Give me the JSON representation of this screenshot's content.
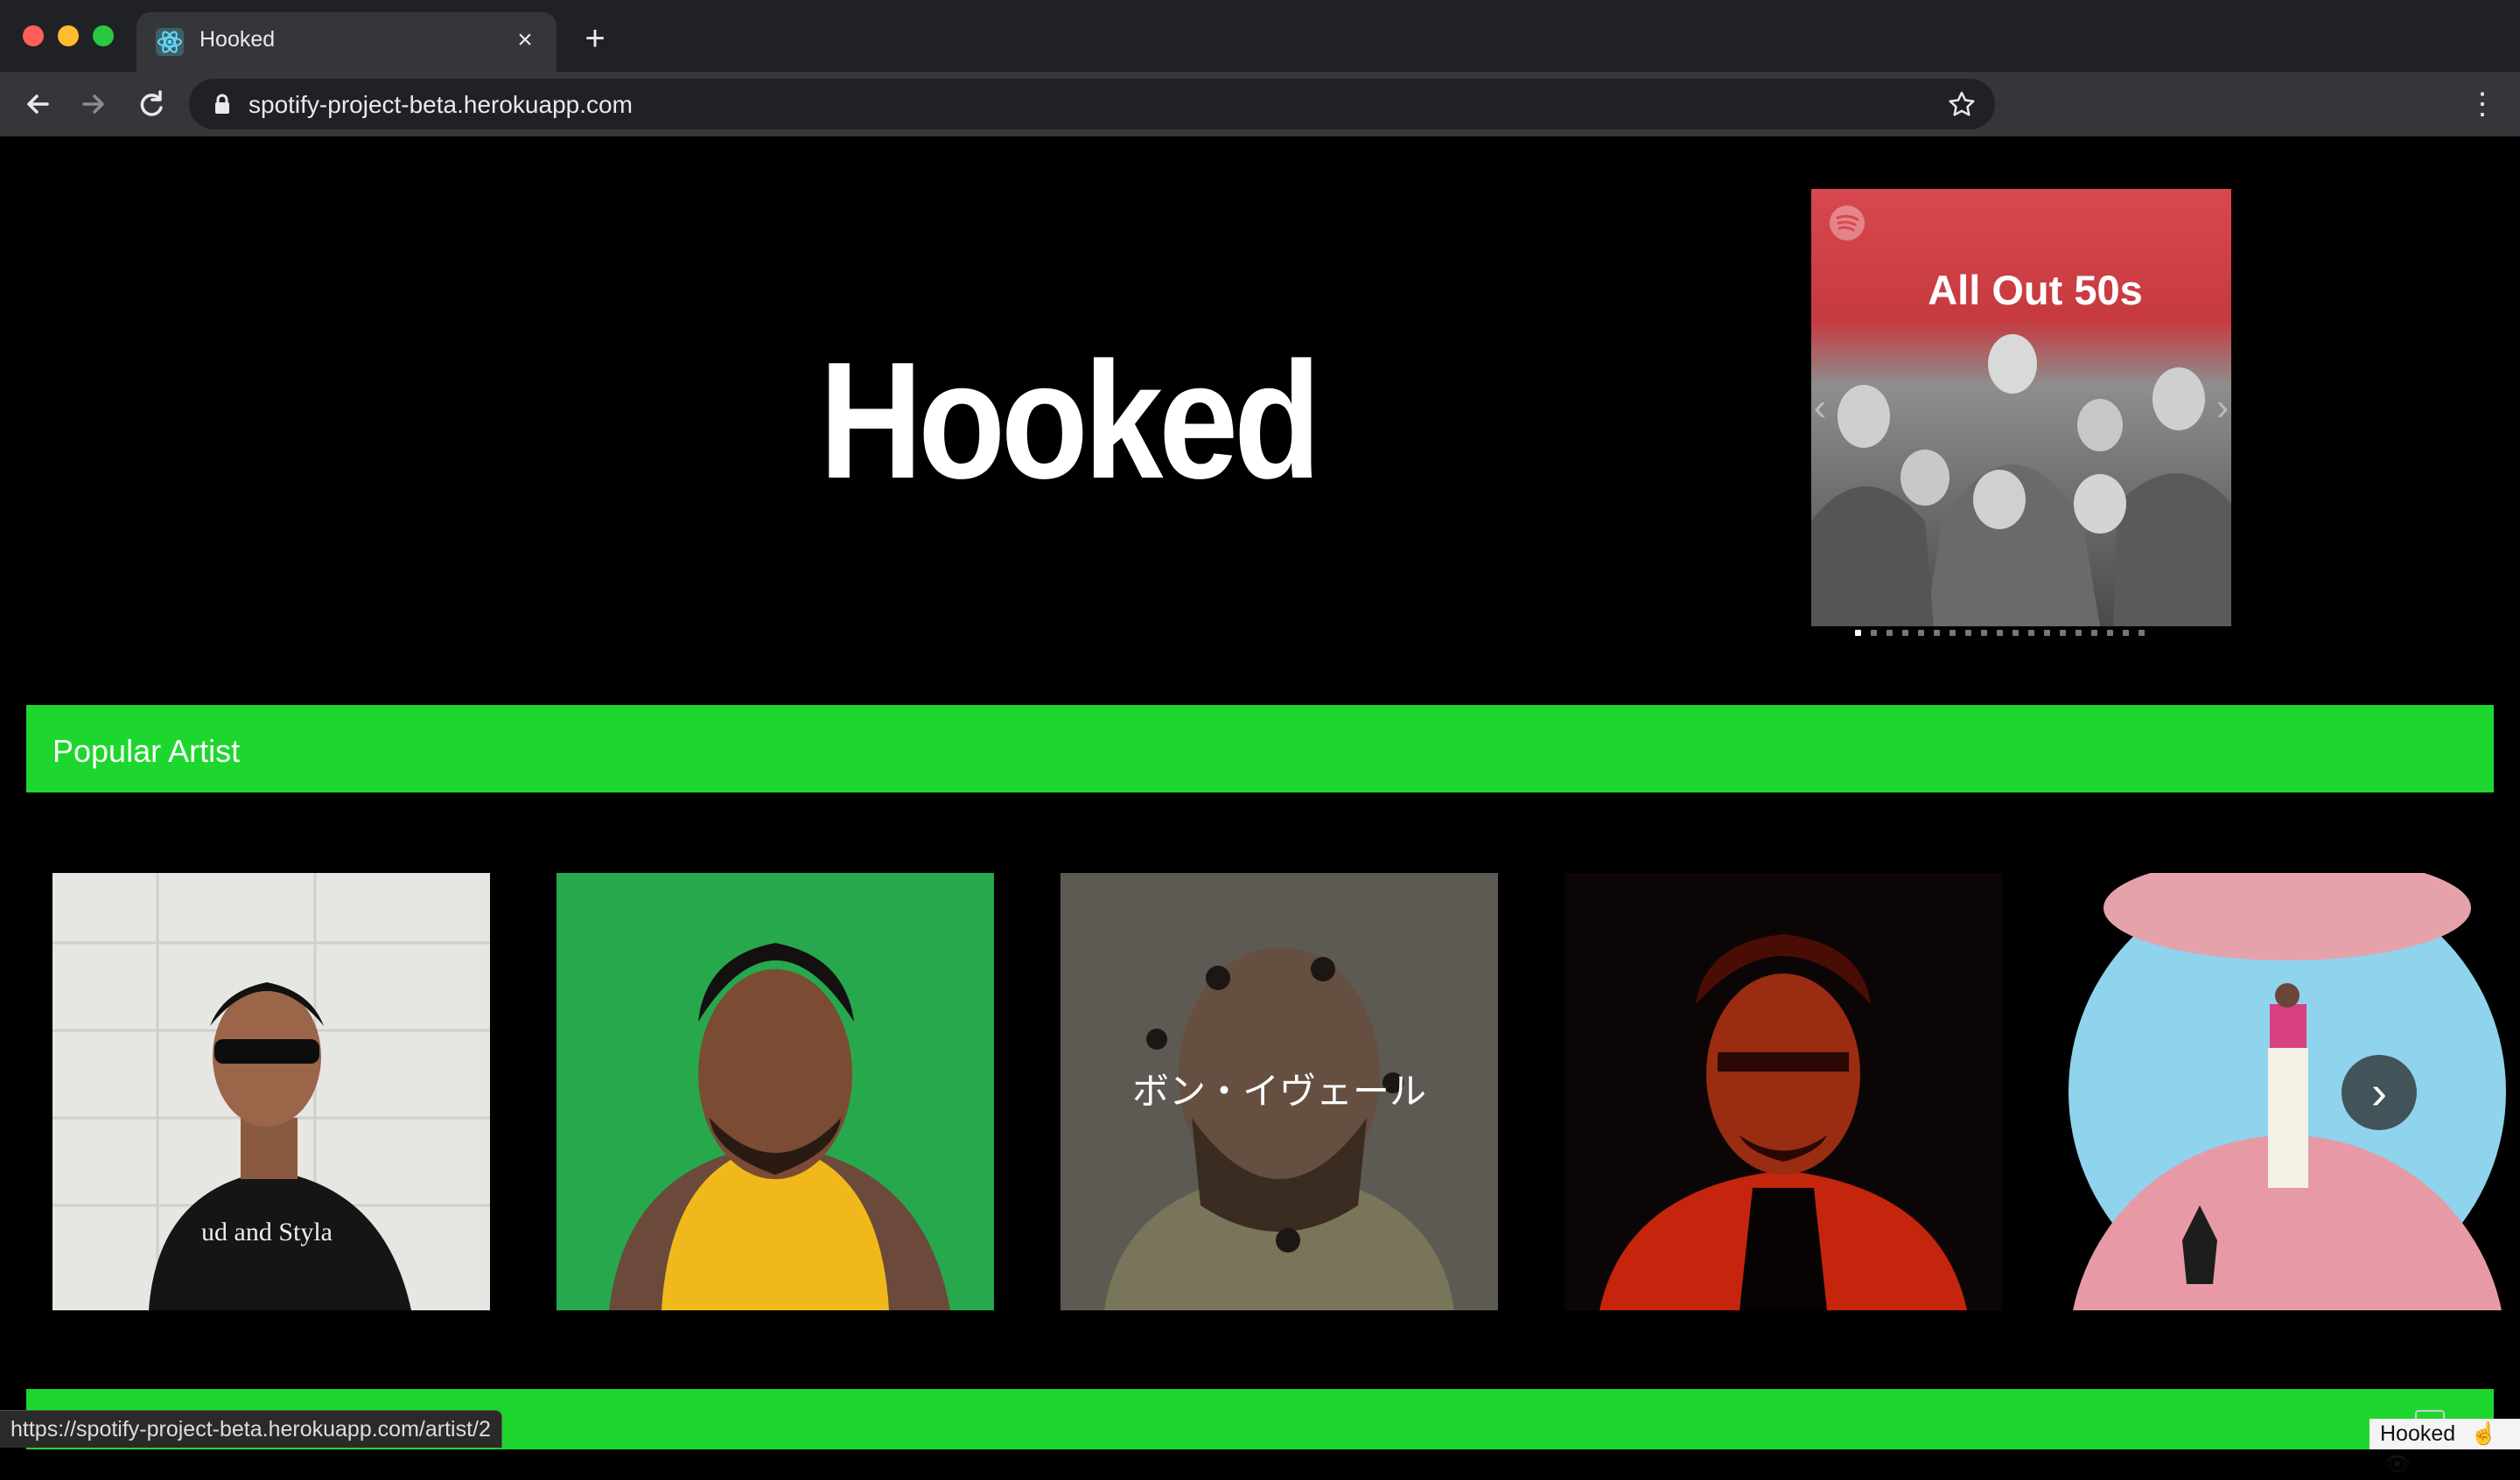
{
  "browser": {
    "tab_title": "Hooked",
    "url": "spotify-project-beta.herokuapp.com",
    "colors": {
      "tabstrip": "#202124",
      "toolbar": "#35363a",
      "text": "#e8eaed"
    }
  },
  "hero": {
    "title": "Hooked",
    "carousel": {
      "current_cover_title": "All Out 50s",
      "dots_total": 19,
      "active_dot_index": 0
    }
  },
  "sections": {
    "popular_artist": {
      "title": "Popular Artist",
      "accent_color": "#1ed72e",
      "artists": [
        {
          "icon": "artist-photo-1",
          "overlay": ""
        },
        {
          "icon": "artist-photo-2",
          "overlay": ""
        },
        {
          "icon": "artist-photo-3",
          "overlay": "ボン・イヴェール"
        },
        {
          "icon": "artist-photo-4",
          "overlay": ""
        },
        {
          "icon": "artist-photo-5",
          "overlay": ""
        }
      ]
    }
  },
  "status": {
    "link_preview": "https://spotify-project-beta.herokuapp.com/artist/2",
    "extension_label": "Hooked"
  }
}
